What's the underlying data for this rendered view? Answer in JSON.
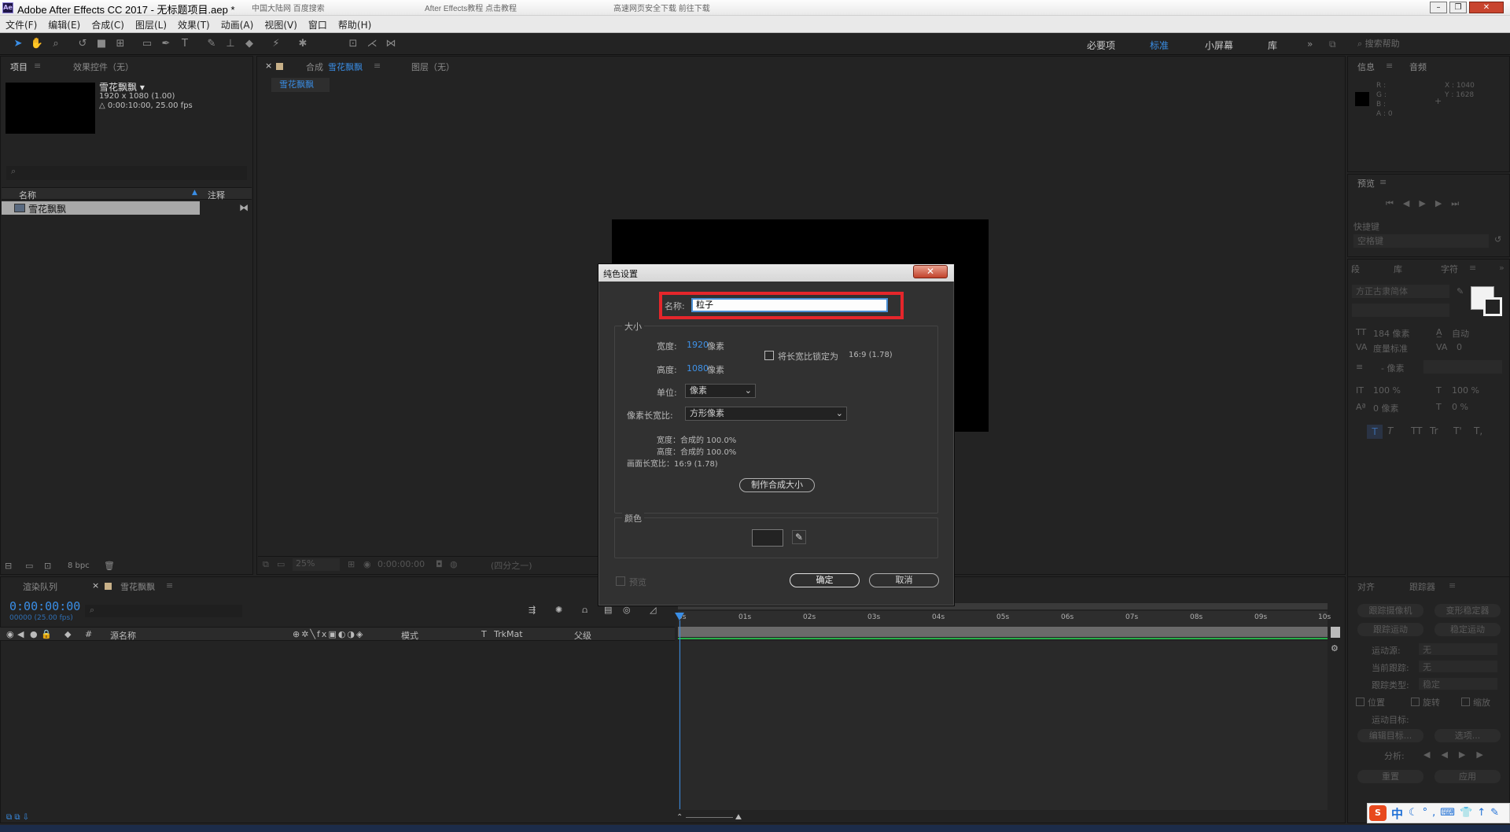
{
  "window": {
    "title": "Adobe After Effects CC 2017 - 无标题项目.aep *",
    "bg_tabs": [
      "中国大陆网 百度搜索",
      "After Effects教程 点击教程",
      "高速网页安全下载 前往下载"
    ]
  },
  "menu": [
    "文件(F)",
    "编辑(E)",
    "合成(C)",
    "图层(L)",
    "效果(T)",
    "动画(A)",
    "视图(V)",
    "窗口",
    "帮助(H)"
  ],
  "toolbar": {
    "snap_label": "对齐",
    "workspaces": [
      "必要项",
      "标准",
      "小屏幕",
      "库"
    ],
    "active_workspace": "标准",
    "search_placeholder": "搜索帮助"
  },
  "project": {
    "tab": "项目",
    "effects_tab": "效果控件（无）",
    "comp_name": "雪花飘飘 ▾",
    "comp_size": "1920 x 1080 (1.00)",
    "comp_dur": "△ 0:00:10:00, 25.00 fps",
    "col_name": "名称",
    "col_comment": "注释",
    "item_name": "雪花飘飘",
    "bpc": "8 bpc"
  },
  "viewer": {
    "tab_prefix": "合成",
    "tab_name": "雪花飘飘",
    "layer_tab": "图层（无）",
    "sub_tab": "雪花飘飘",
    "zoom": "25%",
    "timecode": "0:00:00:00",
    "resolution": "(四分之一)"
  },
  "dialog": {
    "title": "纯色设置",
    "name_label": "名称:",
    "name_value": "粒子",
    "size_label": "大小",
    "width_label": "宽度:",
    "width_value": "1920",
    "width_unit": "像素",
    "height_label": "高度:",
    "height_value": "1080",
    "height_unit": "像素",
    "lock_label": "将长宽比锁定为",
    "lock_ratio": "16:9 (1.78)",
    "units_label": "单位:",
    "units_value": "像素",
    "pixel_aspect_label": "像素长宽比:",
    "pixel_aspect_value": "方形像素",
    "pct_width": "宽度：合成的 100.0%",
    "pct_height": "高度：合成的 100.0%",
    "frame_aspect": "画面长宽比：16:9 (1.78)",
    "make_comp_size": "制作合成大小",
    "color_label": "颜色",
    "swatch_color": "#232323",
    "preview_label": "预览",
    "ok": "确定",
    "cancel": "取消"
  },
  "timeline": {
    "render_tab": "渲染队列",
    "comp_tab": "雪花飘飘",
    "timecode": "0:00:00:00",
    "frames": "00000 (25.00 fps)",
    "col_hash": "#",
    "col_source": "源名称",
    "col_mode": "模式",
    "col_t": "T",
    "col_trkmat": "TrkMat",
    "col_parent": "父级",
    "ruler": [
      "0s",
      "01s",
      "02s",
      "03s",
      "04s",
      "05s",
      "06s",
      "07s",
      "08s",
      "09s",
      "10s"
    ]
  },
  "info": {
    "tab": "信息",
    "audio_tab": "音频",
    "rgb": [
      "R :",
      "G :",
      "B :",
      "A : 0"
    ],
    "x": "X : 1040",
    "y": "Y : 1628"
  },
  "preview": {
    "tab": "预览",
    "shortcut_label": "快捷键",
    "shortcut_value": "空格键"
  },
  "character": {
    "tabs": [
      "段",
      "库",
      "字符"
    ],
    "font": "方正古隶简体",
    "size": "184 像素",
    "leading": "自动",
    "kerning": "度量标准",
    "tracking": "0",
    "line_px": "- 像素",
    "vscale": "100 %",
    "hscale": "100 %",
    "baseline": "0 像素",
    "tsume": "0 %",
    "styles": [
      "T",
      "T",
      "TT",
      "Tr",
      "T'",
      "T,"
    ]
  },
  "tracker": {
    "tabs": [
      "对齐",
      "跟踪器"
    ],
    "track_camera": "跟踪摄像机",
    "warp_stab": "变形稳定器",
    "track_motion": "跟踪运动",
    "stabilize": "稳定运动",
    "source_label": "运动源:",
    "source_val": "无",
    "current_label": "当前跟踪:",
    "current_val": "无",
    "type_label": "跟踪类型:",
    "type_val": "稳定",
    "cb_pos": "位置",
    "cb_rot": "旋转",
    "cb_scale": "缩放",
    "target_label": "运动目标:",
    "edit_target": "编辑目标...",
    "options": "选项...",
    "analyze_label": "分析:",
    "reset": "重置",
    "apply": "应用"
  },
  "ime": {
    "logo": "S",
    "lang": "中"
  }
}
